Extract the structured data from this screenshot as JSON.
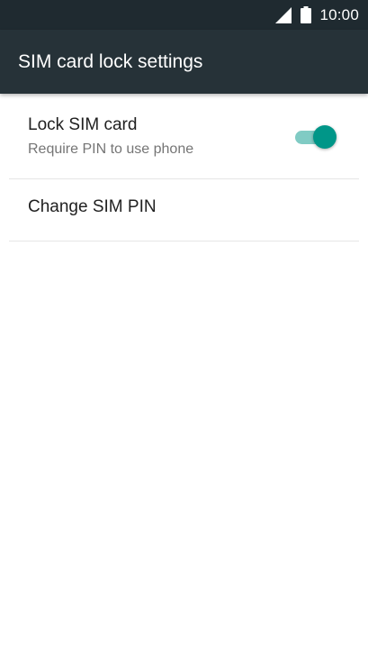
{
  "status_bar": {
    "time": "10:00",
    "icons": [
      "signal-icon",
      "battery-icon"
    ]
  },
  "app_bar": {
    "title": "SIM card lock settings"
  },
  "settings": [
    {
      "title": "Lock SIM card",
      "summary": "Require PIN to use phone",
      "toggle_on": true
    },
    {
      "title": "Change SIM PIN"
    }
  ],
  "colors": {
    "status_bar": "#1f2a30",
    "app_bar": "#263238",
    "accent": "#009688",
    "accent_track": "#80cbc4",
    "divider": "#e6e6e6"
  }
}
